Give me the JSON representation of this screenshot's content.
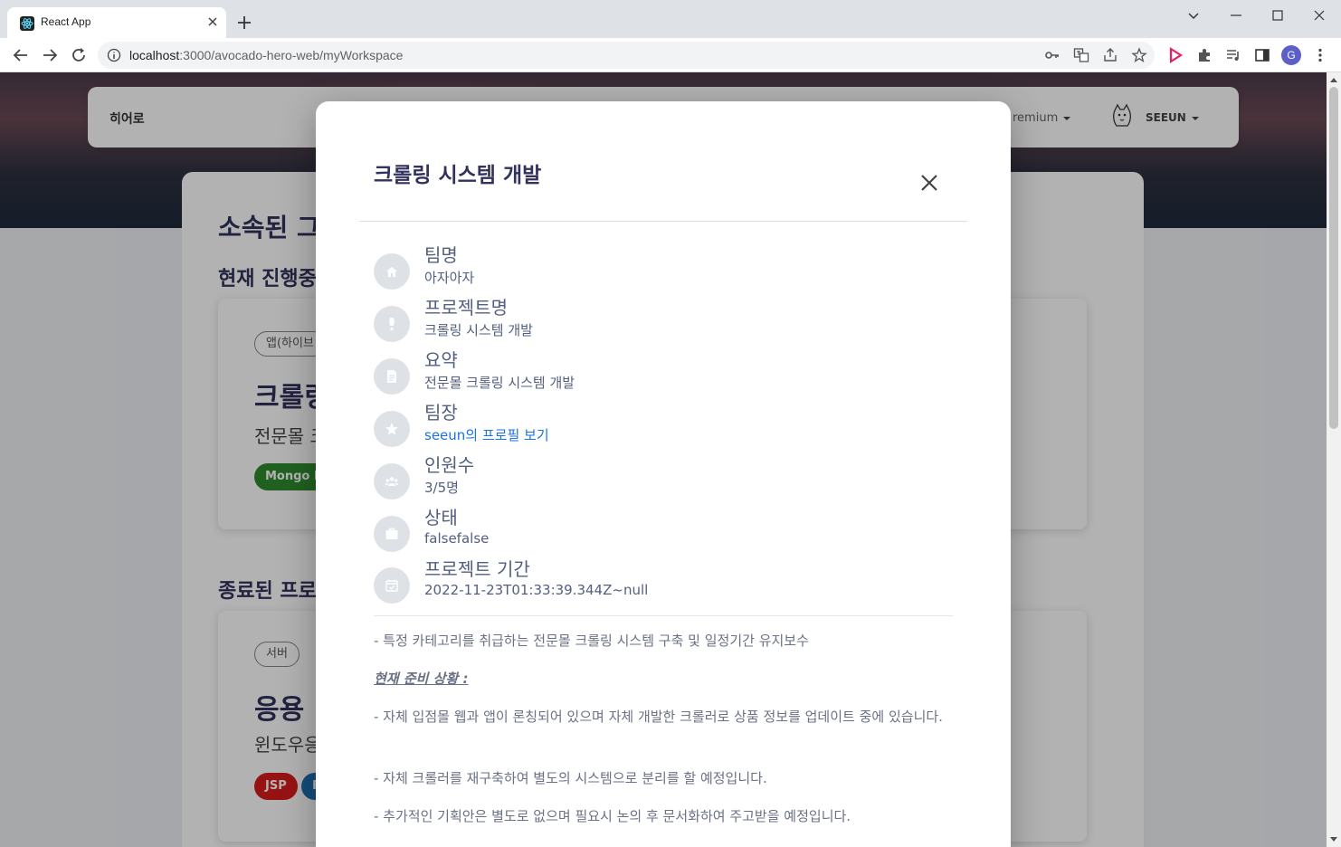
{
  "browser": {
    "tab_title": "React App",
    "url_host": "localhost",
    "url_path": ":3000/avocado-hero-web/myWorkspace",
    "profile_initial": "G"
  },
  "page": {
    "brand": "히어로",
    "nav_premium": "remium",
    "nav_user": "SEEUN",
    "section_title": "소속된 그",
    "current_subtitle": "현재 진행중",
    "ended_subtitle": "종료된 프로",
    "card1": {
      "chip": "앱(하이브",
      "title": "크롤링",
      "desc": "전문몰 크",
      "tech": [
        "Mongo DB"
      ]
    },
    "card2": {
      "chip": "서버",
      "title": "응용",
      "desc": "윈도우응",
      "tech": [
        "JSP",
        "R"
      ]
    }
  },
  "modal": {
    "title": "크롤링 시스템 개발",
    "rows": [
      {
        "label": "팀명",
        "value": "아자아자",
        "icon": "home-icon"
      },
      {
        "label": "프로젝트명",
        "value": "크롤링 시스템 개발",
        "icon": "exclamation-icon"
      },
      {
        "label": "요약",
        "value": "전문몰 크롤링 시스템 개발",
        "icon": "document-icon"
      },
      {
        "label": "팀장",
        "value": "seeun의 프로필 보기",
        "icon": "star-icon"
      },
      {
        "label": "인원수",
        "value": "3/5명",
        "icon": "people-icon"
      },
      {
        "label": "상태",
        "value": "falsefalse",
        "icon": "briefcase-icon"
      },
      {
        "label": "프로젝트 기간",
        "value": "2022-11-23T01:33:39.344Z~null",
        "icon": "calendar-icon"
      }
    ],
    "body": [
      "- 특정 카테고리를 취급하는 전문몰 크롤링 시스템 구축 및 일정기간 유지보수",
      "현재 준비 상황 :",
      "- 자체 입점몰 웹과 앱이 론칭되어 있으며 자체 개발한 크롤러로 상품 정보를 업데이트 중에 있습니다.",
      "- 자체 크롤러를 재구축하여 별도의 시스템으로 분리를 할 예정입니다.",
      "- 추가적인 기획안은 별도로 없으며 필요시 논의 후 문서화하여 주고받을 예정입니다."
    ]
  },
  "colors": {
    "accent": "#32325d",
    "link": "#1a73e8",
    "mongo": "#2e8b2e",
    "jsp": "#d91c1c",
    "r": "#1e6fb0"
  }
}
